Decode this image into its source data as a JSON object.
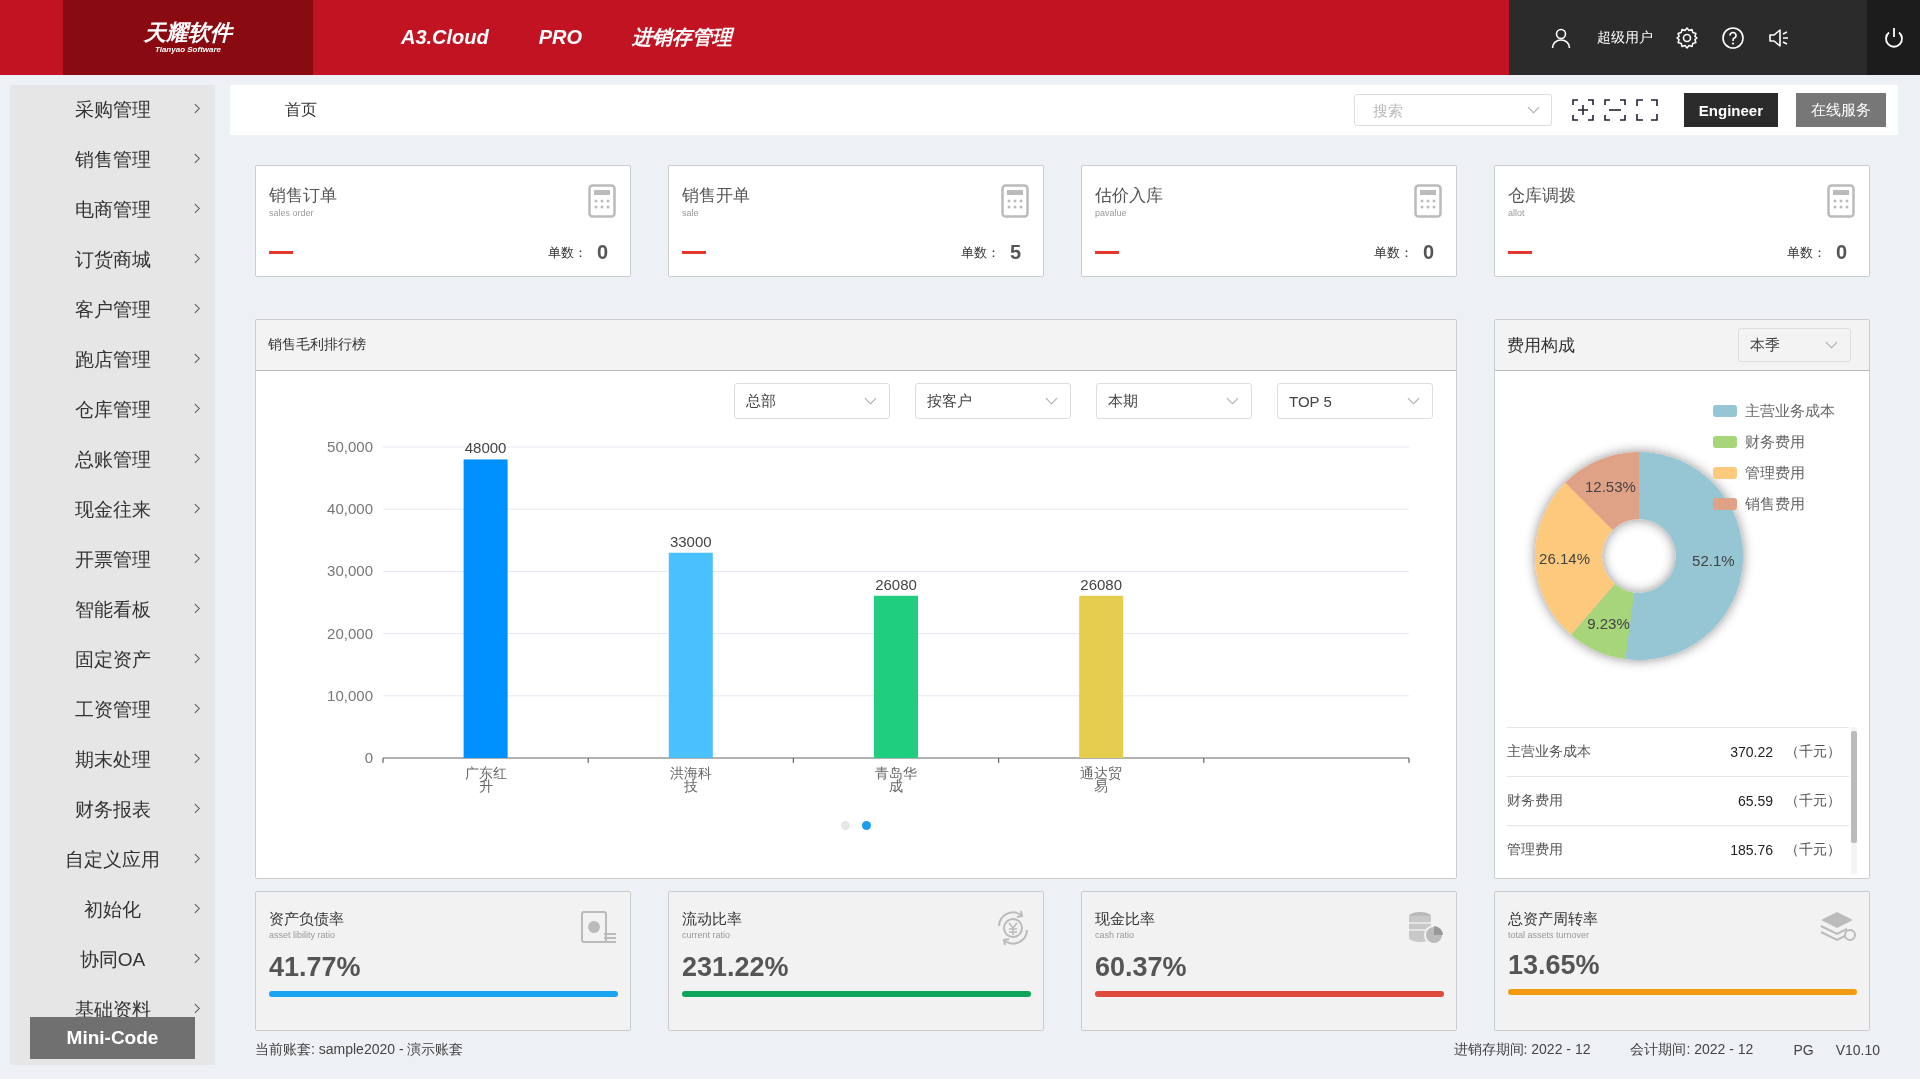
{
  "header": {
    "logo": {
      "name": "天耀软件",
      "subtitle": "Tianyao Software"
    },
    "nav": [
      "A3.Cloud",
      "PRO",
      "进销存管理"
    ],
    "user": "超级用户"
  },
  "sidebar": {
    "items": [
      {
        "label": "采购管理"
      },
      {
        "label": "销售管理"
      },
      {
        "label": "电商管理"
      },
      {
        "label": "订货商城"
      },
      {
        "label": "客户管理"
      },
      {
        "label": "跑店管理"
      },
      {
        "label": "仓库管理"
      },
      {
        "label": "总账管理"
      },
      {
        "label": "现金往来"
      },
      {
        "label": "开票管理"
      },
      {
        "label": "智能看板"
      },
      {
        "label": "固定资产"
      },
      {
        "label": "工资管理"
      },
      {
        "label": "期末处理"
      },
      {
        "label": "财务报表"
      },
      {
        "label": "自定义应用"
      },
      {
        "label": "初始化"
      },
      {
        "label": "协同OA"
      },
      {
        "label": "基础资料"
      }
    ],
    "mini_code": "Mini-Code"
  },
  "breadcrumb": [
    "首页"
  ],
  "toolbar": {
    "search": {
      "placeholder": "搜索"
    },
    "buttons": [
      "Engineer",
      "在线服务"
    ]
  },
  "stat_cards": [
    {
      "title": "销售订单",
      "subtitle": "sales order",
      "count_label": "单数：",
      "count": "0"
    },
    {
      "title": "销售开单",
      "subtitle": "sale",
      "count_label": "单数：",
      "count": "5"
    },
    {
      "title": "估价入库",
      "subtitle": "pavalue",
      "count_label": "单数：",
      "count": "0"
    },
    {
      "title": "仓库调拨",
      "subtitle": "allot",
      "count_label": "单数：",
      "count": "0"
    }
  ],
  "sales_ranking": {
    "title": "销售毛利排行榜",
    "filters": [
      "总部",
      "按客户",
      "本期",
      "TOP 5"
    ],
    "chart_data": {
      "type": "bar",
      "categories": [
        "广东红升",
        "洪海科技",
        "青岛华成",
        "通达贸易"
      ],
      "values": [
        48000,
        33000,
        26080,
        26080
      ],
      "ylim": [
        0,
        50000
      ],
      "yticks": [
        {
          "value": 0,
          "label": "0"
        },
        {
          "value": 10000,
          "label": "10,000"
        },
        {
          "value": 20000,
          "label": "20,000"
        },
        {
          "value": 30000,
          "label": "30,000"
        },
        {
          "value": 40000,
          "label": "40,000"
        },
        {
          "value": 50000,
          "label": "50,000"
        }
      ],
      "grid": true,
      "data_labels": true,
      "colors": [
        "#0090ff",
        "#4bc0ff",
        "#1fcf7f",
        "#e5cd4e"
      ]
    },
    "carousel_dots": [
      {
        "selected": false
      },
      {
        "selected": true
      }
    ]
  },
  "expense": {
    "title": "费用构成",
    "period": "本季",
    "chart_data": {
      "type": "donut",
      "categories": [
        "主营业务成本",
        "财务费用",
        "管理费用",
        "销售费用"
      ],
      "values": [
        52.1,
        9.23,
        26.14,
        12.53
      ],
      "value_labels": [
        "52.1%",
        "9.23%",
        "26.14%",
        "12.53%"
      ],
      "legend": true,
      "colors": [
        "#96c5d4",
        "#a6d57a",
        "#fdc97d",
        "#e0a286"
      ]
    },
    "rows": [
      {
        "name": "主营业务成本",
        "value": "370.22",
        "unit": "（千元）"
      },
      {
        "name": "财务费用",
        "value": "65.59",
        "unit": "（千元）"
      },
      {
        "name": "管理费用",
        "value": "185.76",
        "unit": "（千元）"
      }
    ]
  },
  "ratio_cards": [
    {
      "kind": "document",
      "title": "资产负债率",
      "subtitle": "asset libility ratio",
      "value": "41.77%",
      "level": 1,
      "color": "#1aa3f0"
    },
    {
      "kind": "exchange",
      "title": "流动比率",
      "subtitle": "current ratio",
      "value": "231.22%",
      "level": 1,
      "color": "#0ea55a"
    },
    {
      "kind": "coins",
      "title": "现金比率",
      "subtitle": "cash ratio",
      "value": "60.37%",
      "level": 1,
      "color": "#e04a3c"
    },
    {
      "kind": "layers",
      "title": "总资产周转率",
      "subtitle": "total assets turnover",
      "value": "13.65%",
      "level": 1,
      "color": "#f29b12"
    }
  ],
  "footer": {
    "account": "当前账套: sample2020 - 演示账套",
    "items": [
      "进销存期间: 2022 - 12",
      "会计期间: 2022 - 12",
      "PG",
      "V10.10"
    ]
  }
}
